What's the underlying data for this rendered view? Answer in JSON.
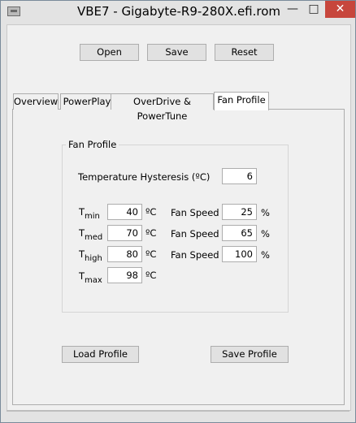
{
  "window": {
    "title": "VBE7 - Gigabyte-R9-280X.efi.rom",
    "min_glyph": "—",
    "max_glyph": "□",
    "close_glyph": "✕"
  },
  "toolbar": {
    "open_label": "Open",
    "save_label": "Save",
    "reset_label": "Reset"
  },
  "tabs": [
    {
      "label": "Overview"
    },
    {
      "label": "PowerPlay"
    },
    {
      "label": "OverDrive & PowerTune"
    },
    {
      "label": "Fan Profile",
      "active": true
    }
  ],
  "fan_profile": {
    "group_title": "Fan Profile",
    "hysteresis_label": "Temperature Hysteresis (ºC)",
    "hysteresis_value": "6",
    "unit_c": "ºC",
    "unit_pct": "%",
    "fan_speed_label": "Fan Speed",
    "rows": [
      {
        "t_main": "T",
        "t_sub": "min",
        "temp": "40",
        "speed": "25"
      },
      {
        "t_main": "T",
        "t_sub": "med",
        "temp": "70",
        "speed": "65"
      },
      {
        "t_main": "T",
        "t_sub": "high",
        "temp": "80",
        "speed": "100"
      },
      {
        "t_main": "T",
        "t_sub": "max",
        "temp": "98"
      }
    ],
    "load_label": "Load Profile",
    "save_label": "Save Profile"
  },
  "colors": {
    "close_button": "#c7463c",
    "window_frame": "#e3e3e3",
    "client_bg": "#f0f0f0"
  }
}
